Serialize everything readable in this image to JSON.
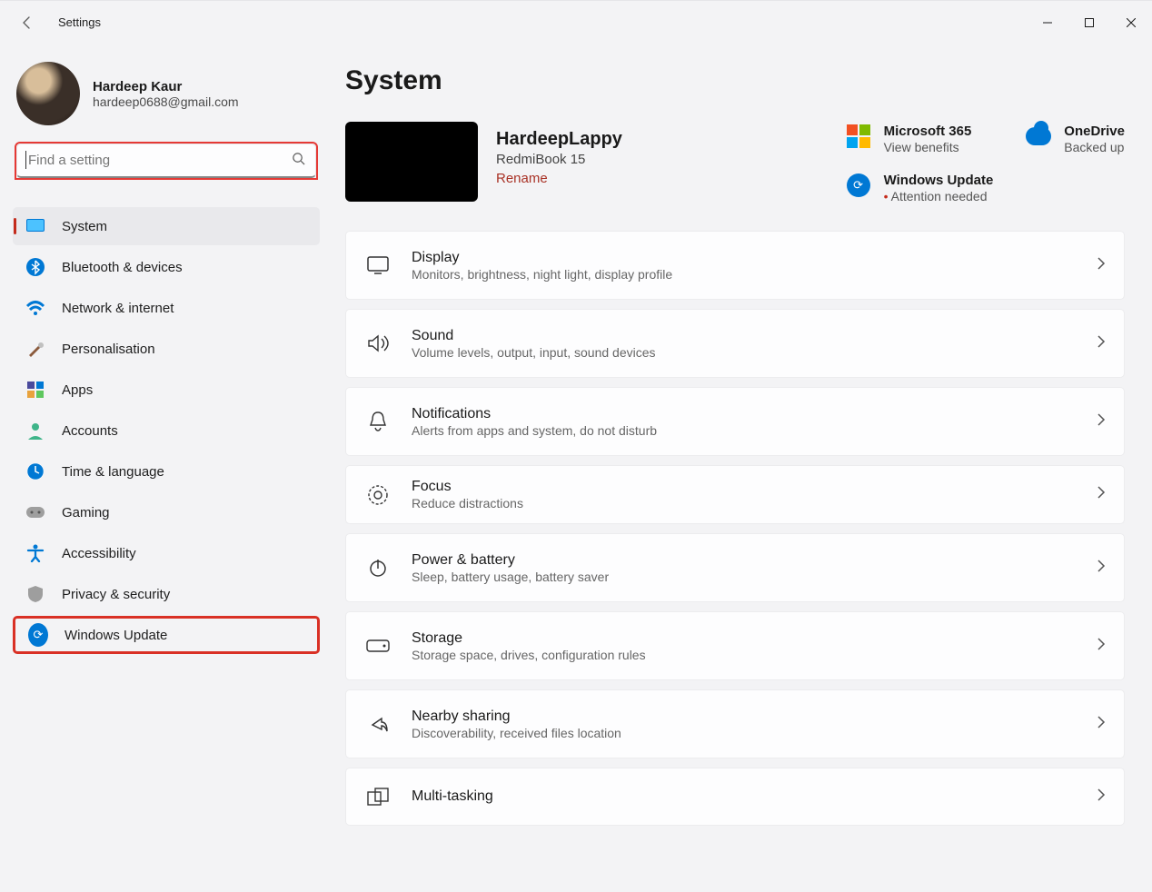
{
  "window": {
    "title": "Settings"
  },
  "profile": {
    "name": "Hardeep Kaur",
    "email": "hardeep0688@gmail.com"
  },
  "search": {
    "placeholder": "Find a setting"
  },
  "nav": {
    "items": [
      {
        "label": "System"
      },
      {
        "label": "Bluetooth & devices"
      },
      {
        "label": "Network & internet"
      },
      {
        "label": "Personalisation"
      },
      {
        "label": "Apps"
      },
      {
        "label": "Accounts"
      },
      {
        "label": "Time & language"
      },
      {
        "label": "Gaming"
      },
      {
        "label": "Accessibility"
      },
      {
        "label": "Privacy & security"
      },
      {
        "label": "Windows Update"
      }
    ]
  },
  "page": {
    "title": "System"
  },
  "device": {
    "name": "HardeepLappy",
    "model": "RedmiBook 15",
    "rename": "Rename"
  },
  "status": {
    "ms365": {
      "title": "Microsoft 365",
      "sub": "View benefits"
    },
    "onedrive": {
      "title": "OneDrive",
      "sub": "Backed up"
    },
    "update": {
      "title": "Windows Update",
      "sub": "Attention needed"
    }
  },
  "rows": [
    {
      "title": "Display",
      "sub": "Monitors, brightness, night light, display profile"
    },
    {
      "title": "Sound",
      "sub": "Volume levels, output, input, sound devices"
    },
    {
      "title": "Notifications",
      "sub": "Alerts from apps and system, do not disturb"
    },
    {
      "title": "Focus",
      "sub": "Reduce distractions"
    },
    {
      "title": "Power & battery",
      "sub": "Sleep, battery usage, battery saver"
    },
    {
      "title": "Storage",
      "sub": "Storage space, drives, configuration rules"
    },
    {
      "title": "Nearby sharing",
      "sub": "Discoverability, received files location"
    },
    {
      "title": "Multi-tasking",
      "sub": ""
    }
  ]
}
